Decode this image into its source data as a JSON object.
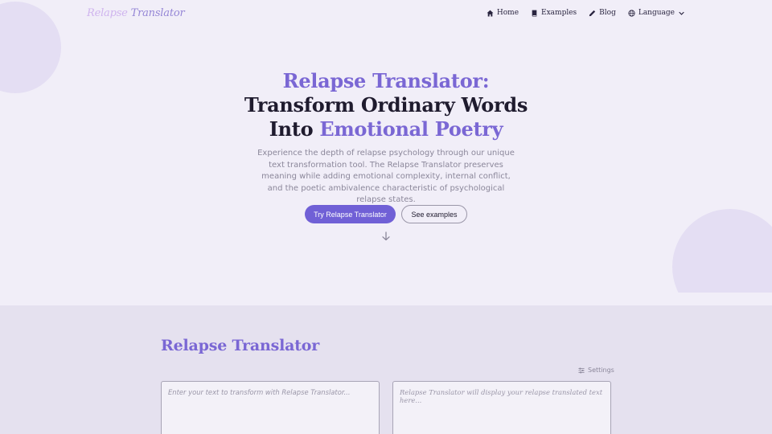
{
  "nav": {
    "logo_part1": "Relapse",
    "logo_part2": "Translator",
    "links": [
      {
        "label": "Home",
        "icon": "home-icon"
      },
      {
        "label": "Examples",
        "icon": "book-icon"
      },
      {
        "label": "Blog",
        "icon": "pencil-icon"
      },
      {
        "label": "Language",
        "icon": "globe-icon"
      }
    ]
  },
  "hero": {
    "title_accent": "Relapse Translator:",
    "title_main": "Transform Ordinary Words Into",
    "title_accent2": "Emotional Poetry",
    "description": "Experience the depth of relapse psychology through our unique text transformation tool. The Relapse Translator preserves meaning while adding emotional complexity, internal conflict, and the poetic ambivalence characteristic of psychological relapse states.",
    "primary_button": "Try Relapse Translator",
    "secondary_button": "See examples"
  },
  "translator": {
    "title": "Relapse Translator",
    "settings_label": "Settings",
    "input_placeholder": "Enter your text to transform with Relapse Translator...",
    "output_placeholder": "Relapse Translator will display your relapse translated text here..."
  },
  "colors": {
    "accent": "#7a67d4",
    "primary_button": "#7060d6",
    "background": "#f1eef8",
    "section_background": "#e5e1ef"
  }
}
